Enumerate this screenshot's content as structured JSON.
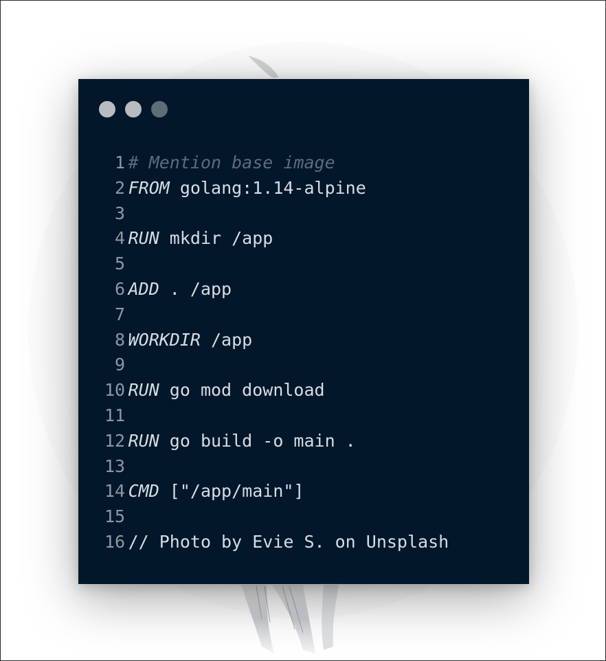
{
  "window": {
    "controls": [
      {
        "name": "close-control-dot",
        "color": "#b8bcc0"
      },
      {
        "name": "minimize-control-dot",
        "color": "#b8bcc0"
      },
      {
        "name": "zoom-control-dot",
        "color": "#5e6e78"
      }
    ]
  },
  "colors": {
    "card_background": "#03172b",
    "text": "#d6dde4",
    "line_numbers": "#8d97a3",
    "comment": "#5d6c7c"
  },
  "code": {
    "language": "dockerfile",
    "lines": [
      {
        "num": "1",
        "keyword": "",
        "text": "",
        "comment": "# Mention base image"
      },
      {
        "num": "2",
        "keyword": "FROM",
        "text": " golang:1.14-alpine",
        "comment": ""
      },
      {
        "num": "3",
        "keyword": "",
        "text": "",
        "comment": ""
      },
      {
        "num": "4",
        "keyword": "RUN",
        "text": " mkdir /app",
        "comment": ""
      },
      {
        "num": "5",
        "keyword": "",
        "text": "",
        "comment": ""
      },
      {
        "num": "6",
        "keyword": "ADD",
        "text": " . /app",
        "comment": ""
      },
      {
        "num": "7",
        "keyword": "",
        "text": "",
        "comment": ""
      },
      {
        "num": "8",
        "keyword": "WORKDIR",
        "text": " /app",
        "comment": ""
      },
      {
        "num": "9",
        "keyword": "",
        "text": "",
        "comment": ""
      },
      {
        "num": "10",
        "keyword": "RUN",
        "text": " go mod download",
        "comment": ""
      },
      {
        "num": "11",
        "keyword": "",
        "text": "",
        "comment": ""
      },
      {
        "num": "12",
        "keyword": "RUN",
        "text": " go build -o main .",
        "comment": ""
      },
      {
        "num": "13",
        "keyword": "",
        "text": "",
        "comment": ""
      },
      {
        "num": "14",
        "keyword": "CMD",
        "text": " [\"/app/main\"]",
        "comment": ""
      },
      {
        "num": "15",
        "keyword": "",
        "text": "",
        "comment": ""
      },
      {
        "num": "16",
        "keyword": "",
        "text": "// Photo by Evie S. on Unsplash",
        "comment": ""
      }
    ]
  }
}
